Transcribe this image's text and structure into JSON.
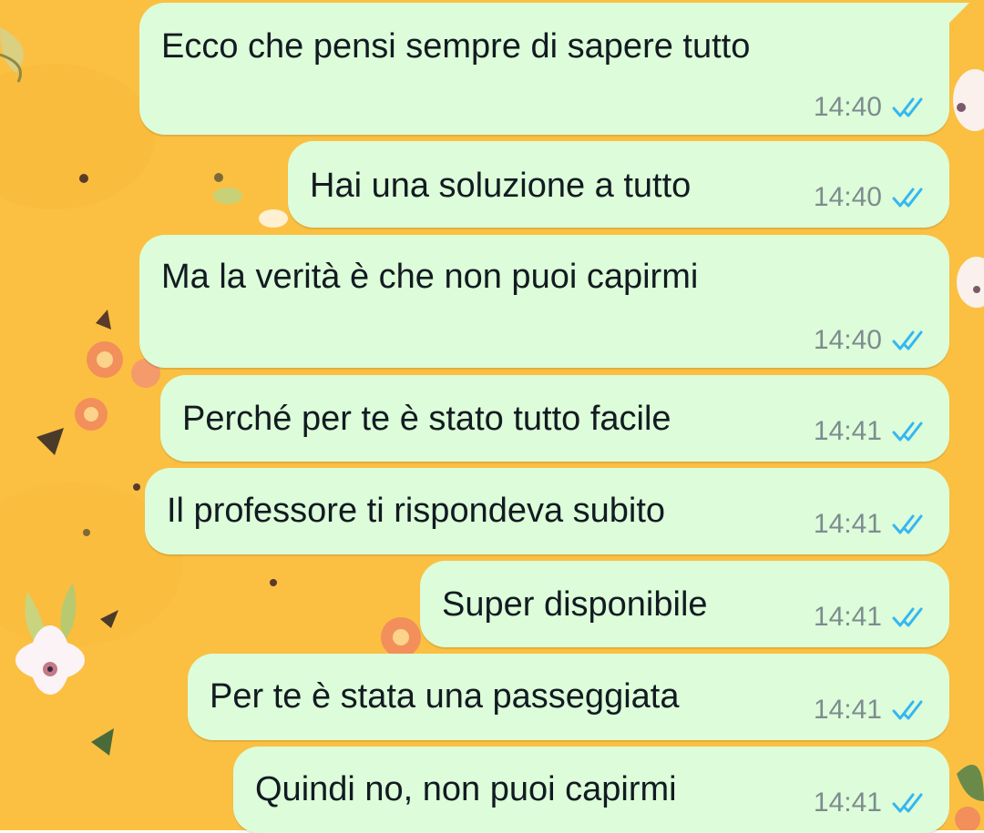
{
  "colors": {
    "wallpaper": "#fbc042",
    "bubble_outgoing": "#ddfcd9",
    "text": "#111b21",
    "timestamp": "#7d8c8f",
    "read_ticks": "#34b7f1"
  },
  "messages": [
    {
      "text": "Ecco che pensi sempre di sapere tutto",
      "time": "14:40",
      "status": "read-double-check-icon"
    },
    {
      "text": "Hai una soluzione a tutto",
      "time": "14:40",
      "status": "read-double-check-icon"
    },
    {
      "text": "Ma la verità è che non puoi capirmi",
      "time": "14:40",
      "status": "read-double-check-icon"
    },
    {
      "text": "Perché per te è stato tutto facile",
      "time": "14:41",
      "status": "read-double-check-icon"
    },
    {
      "text": "Il professore ti rispondeva subito",
      "time": "14:41",
      "status": "read-double-check-icon"
    },
    {
      "text": "Super disponibile",
      "time": "14:41",
      "status": "read-double-check-icon"
    },
    {
      "text": "Per te è stata una passeggiata",
      "time": "14:41",
      "status": "read-double-check-icon"
    },
    {
      "text": "Quindi no,  non puoi capirmi",
      "time": "14:41",
      "status": "read-double-check-icon"
    }
  ]
}
